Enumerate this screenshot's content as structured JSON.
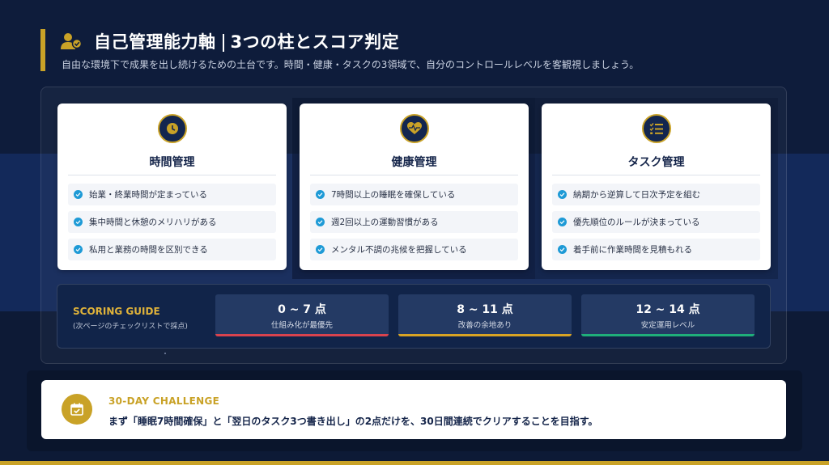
{
  "header": {
    "title_main": "自己管理能力軸",
    "title_sub": "3つの柱とスコア判定",
    "subtitle": "自由な環境下で成果を出し続けるための土台です。時間・健康・タスクの3領域で、自分のコントロールレベルを客観視しましょう。",
    "icon": "users-icon"
  },
  "cards": [
    {
      "title": "時間管理",
      "icon": "clock-icon",
      "items": [
        "始業・終業時間が定まっている",
        "集中時間と休憩のメリハリがある",
        "私用と業務の時間を区別できる"
      ]
    },
    {
      "title": "健康管理",
      "icon": "heartbeat-icon",
      "items": [
        "7時間以上の睡眠を確保している",
        "週2回以上の運動習慣がある",
        "メンタル不調の兆候を把握している"
      ]
    },
    {
      "title": "タスク管理",
      "icon": "checklist-icon",
      "items": [
        "納期から逆算して日次予定を組む",
        "優先順位のルールが決まっている",
        "着手前に作業時間を見積もれる"
      ]
    }
  ],
  "scoring": {
    "label": "SCORING GUIDE",
    "sub": "(次ページのチェックリストで採点)",
    "ranges": [
      {
        "range": "0 ~ 7 点",
        "desc": "仕組み化が最優先",
        "color": "#d9434e"
      },
      {
        "range": "8 ~ 11 点",
        "desc": "改善の余地あり",
        "color": "#d9a424"
      },
      {
        "range": "12 ~ 14 点",
        "desc": "安定運用レベル",
        "color": "#1fae7a"
      }
    ]
  },
  "challenge": {
    "label": "30-DAY CHALLENGE",
    "text": "まず「睡眠7時間確保」と「翌日のタスク3つ書き出し」の2点だけを、30日間連続でクリアすることを目指す。",
    "icon": "calendar-check-icon"
  },
  "colors": {
    "accent": "#c9a227",
    "navy": "#0e1c3b",
    "check": "#1e9ad6"
  }
}
